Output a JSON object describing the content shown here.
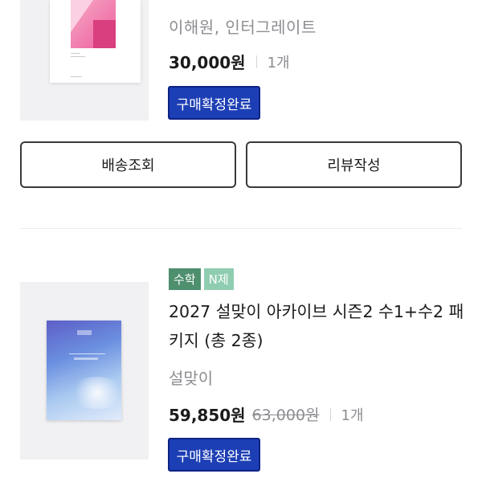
{
  "order_items": [
    {
      "author_publisher": "이해원, 인터그레이트",
      "price": "30,000원",
      "quantity": "1개",
      "status": "구매확정완료",
      "actions": {
        "shipping_label": "배송조회",
        "review_label": "리뷰작성"
      }
    },
    {
      "tags": [
        "수학",
        "N제"
      ],
      "title": "2027 설맞이 아카이브 시즌2 수1+수2 패키지 (총 2종)",
      "author_publisher": "설맞이",
      "price": "59,850원",
      "original_price": "63,000원",
      "quantity": "1개",
      "status": "구매확정완료"
    }
  ],
  "colors": {
    "status_badge": "#1d3fb5",
    "tag_subject": "#4e8f6e",
    "tag_ntest": "#8fcdb0",
    "muted_text": "#8d8d92"
  },
  "icons": {
    "book1_cover": "book-cover-pink",
    "book2_cover": "book-cover-blue"
  }
}
